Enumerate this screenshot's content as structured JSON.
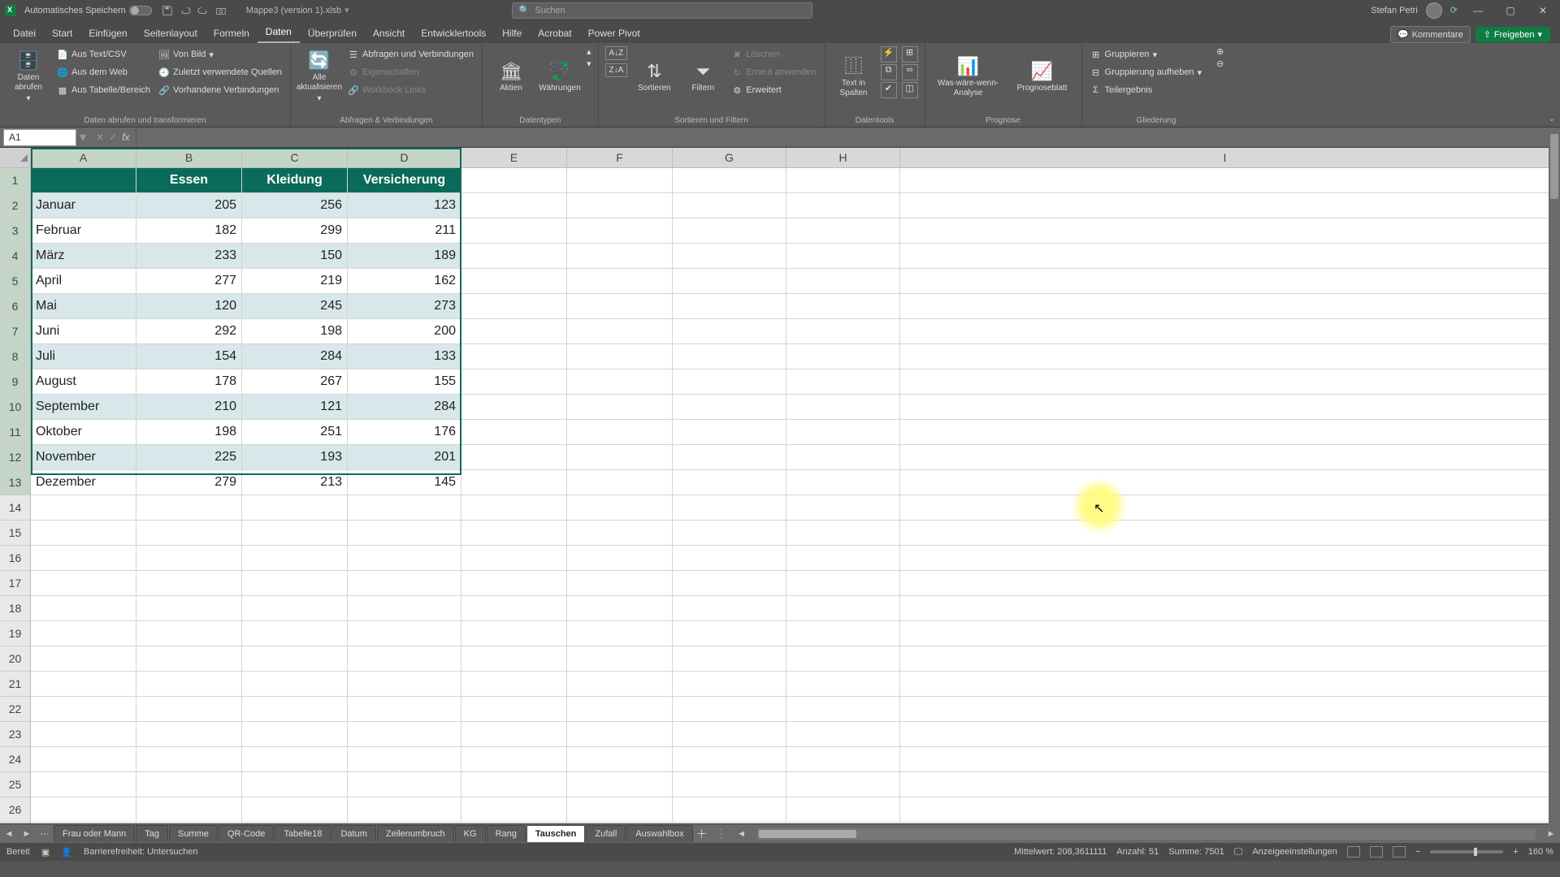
{
  "titlebar": {
    "autosave_label": "Automatisches Speichern",
    "filename": "Mappe3 (version 1).xlsb",
    "search_placeholder": "Suchen",
    "user_name": "Stefan Petri"
  },
  "tabs": [
    "Datei",
    "Start",
    "Einfügen",
    "Seitenlayout",
    "Formeln",
    "Daten",
    "Überprüfen",
    "Ansicht",
    "Entwicklertools",
    "Hilfe",
    "Acrobat",
    "Power Pivot"
  ],
  "active_tab": "Daten",
  "ribbon_right": {
    "comments": "Kommentare",
    "share": "Freigeben"
  },
  "ribbon": {
    "g1": {
      "big": "Daten\nabrufen",
      "items": [
        "Aus Text/CSV",
        "Von Bild",
        "Aus dem Web",
        "Zuletzt verwendete Quellen",
        "Aus Tabelle/Bereich",
        "Vorhandene Verbindungen"
      ],
      "label": "Daten abrufen und transformieren"
    },
    "g2": {
      "big": "Alle\naktualisieren",
      "items": [
        "Abfragen und Verbindungen",
        "Eigenschaften",
        "Workbook Links"
      ],
      "label": "Abfragen & Verbindungen"
    },
    "g3": {
      "stocks": "Aktien",
      "currencies": "Währungen",
      "label": "Datentypen"
    },
    "g4": {
      "sort": "Sortieren",
      "filter": "Filtern",
      "clear": "Löschen",
      "reapply": "Erneut anwenden",
      "advanced": "Erweitert",
      "label": "Sortieren und Filtern"
    },
    "g5": {
      "text": "Text in\nSpalten",
      "label": "Datentools"
    },
    "g6": {
      "whatif": "Was-wäre-wenn-\nAnalyse",
      "forecast": "Prognoseblatt",
      "label": "Prognose"
    },
    "g7": {
      "group": "Gruppieren",
      "ungroup": "Gruppierung aufheben",
      "subtotal": "Teilergebnis",
      "label": "Gliederung"
    }
  },
  "name_box": "A1",
  "columns_visible": [
    "A",
    "B",
    "C",
    "D",
    "E",
    "F",
    "G",
    "H",
    "I"
  ],
  "headers": [
    "",
    "Essen",
    "Kleidung",
    "Versicherung"
  ],
  "rows": [
    [
      "Januar",
      205,
      256,
      123
    ],
    [
      "Februar",
      182,
      299,
      211
    ],
    [
      "März",
      233,
      150,
      189
    ],
    [
      "April",
      277,
      219,
      162
    ],
    [
      "Mai",
      120,
      245,
      273
    ],
    [
      "Juni",
      292,
      198,
      200
    ],
    [
      "Juli",
      154,
      284,
      133
    ],
    [
      "August",
      178,
      267,
      155
    ],
    [
      "September",
      210,
      121,
      284
    ],
    [
      "Oktober",
      198,
      251,
      176
    ],
    [
      "November",
      225,
      193,
      201
    ],
    [
      "Dezember",
      279,
      213,
      145
    ]
  ],
  "sheets": [
    "Frau oder Mann",
    "Tag",
    "Summe",
    "QR-Code",
    "Tabelle18",
    "Datum",
    "Zeilenumbruch",
    "KG",
    "Rang",
    "Tauschen",
    "Zufall",
    "Auswahlbox"
  ],
  "active_sheet": "Tauschen",
  "status": {
    "ready": "Bereit",
    "accessibility": "Barrierefreiheit: Untersuchen",
    "avg": "Mittelwert: 208,3611111",
    "count": "Anzahl: 51",
    "sum": "Summe: 7501",
    "display_settings": "Anzeigeeinstellungen",
    "zoom": "160 %"
  }
}
